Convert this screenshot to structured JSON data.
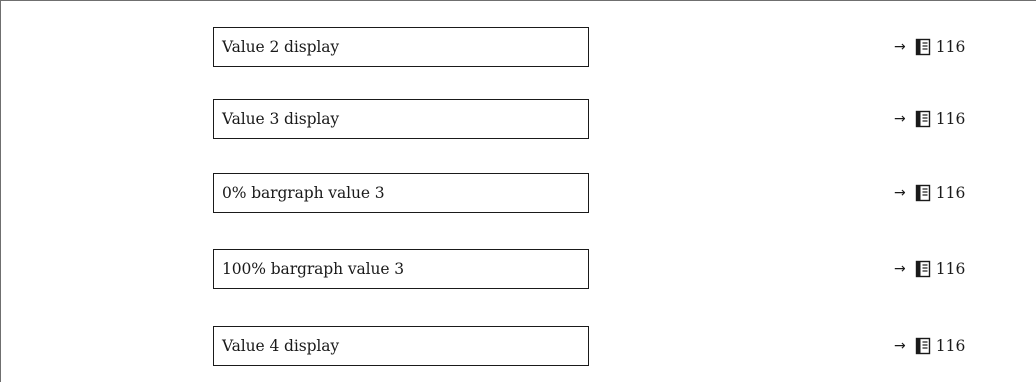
{
  "rows": [
    {
      "label": "Value 2 display",
      "ref_page": "116"
    },
    {
      "label": "Value 3 display",
      "ref_page": "116"
    },
    {
      "label": "0% bargraph value 3",
      "ref_page": "116"
    },
    {
      "label": "100% bargraph value 3",
      "ref_page": "116"
    },
    {
      "label": "Value 4 display",
      "ref_page": "116"
    }
  ],
  "ref_arrow": "→",
  "icons": {
    "reference": "page-reference-icon"
  }
}
